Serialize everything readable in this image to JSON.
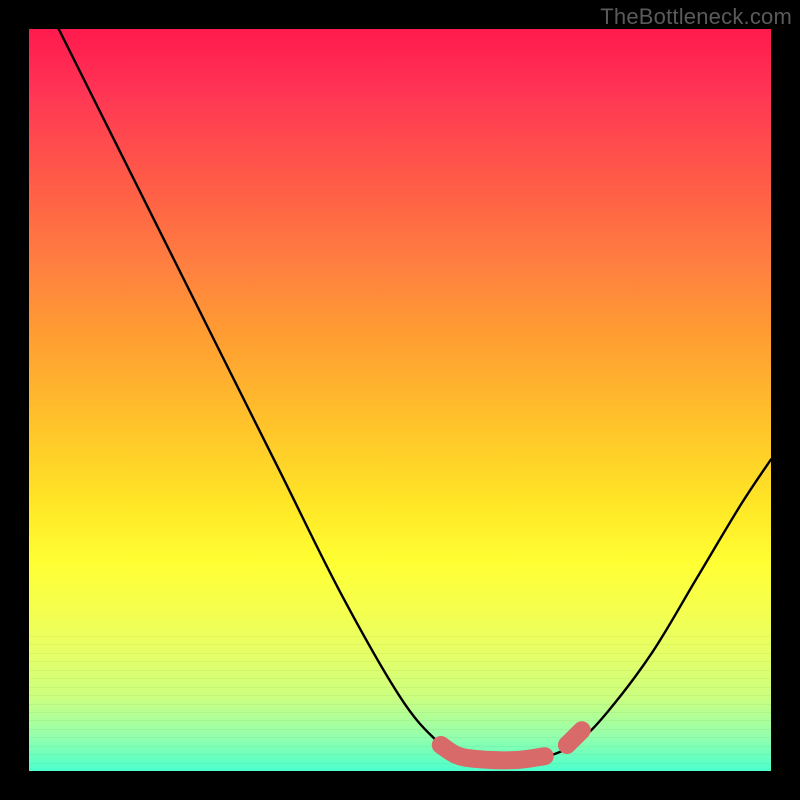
{
  "watermark": "TheBottleneck.com",
  "chart_data": {
    "type": "line",
    "title": "",
    "xlabel": "",
    "ylabel": "",
    "ylim": [
      0,
      100
    ],
    "series": [
      {
        "name": "curve",
        "points": [
          {
            "x": 0.04,
            "y": 1.0
          },
          {
            "x": 0.1,
            "y": 0.88
          },
          {
            "x": 0.18,
            "y": 0.72
          },
          {
            "x": 0.26,
            "y": 0.56
          },
          {
            "x": 0.34,
            "y": 0.4
          },
          {
            "x": 0.42,
            "y": 0.24
          },
          {
            "x": 0.5,
            "y": 0.1
          },
          {
            "x": 0.55,
            "y": 0.04
          },
          {
            "x": 0.58,
            "y": 0.02
          },
          {
            "x": 0.62,
            "y": 0.015
          },
          {
            "x": 0.66,
            "y": 0.015
          },
          {
            "x": 0.7,
            "y": 0.02
          },
          {
            "x": 0.74,
            "y": 0.04
          },
          {
            "x": 0.78,
            "y": 0.08
          },
          {
            "x": 0.84,
            "y": 0.16
          },
          {
            "x": 0.9,
            "y": 0.26
          },
          {
            "x": 0.96,
            "y": 0.36
          },
          {
            "x": 1.0,
            "y": 0.42
          }
        ]
      },
      {
        "name": "highlight-flat",
        "points": [
          {
            "x": 0.555,
            "y": 0.035
          },
          {
            "x": 0.58,
            "y": 0.02
          },
          {
            "x": 0.62,
            "y": 0.015
          },
          {
            "x": 0.66,
            "y": 0.015
          },
          {
            "x": 0.695,
            "y": 0.02
          }
        ]
      },
      {
        "name": "highlight-right",
        "points": [
          {
            "x": 0.725,
            "y": 0.035
          },
          {
            "x": 0.745,
            "y": 0.055
          }
        ]
      }
    ],
    "colors": {
      "curve": "#000000",
      "highlight": "#d86a6a"
    }
  }
}
